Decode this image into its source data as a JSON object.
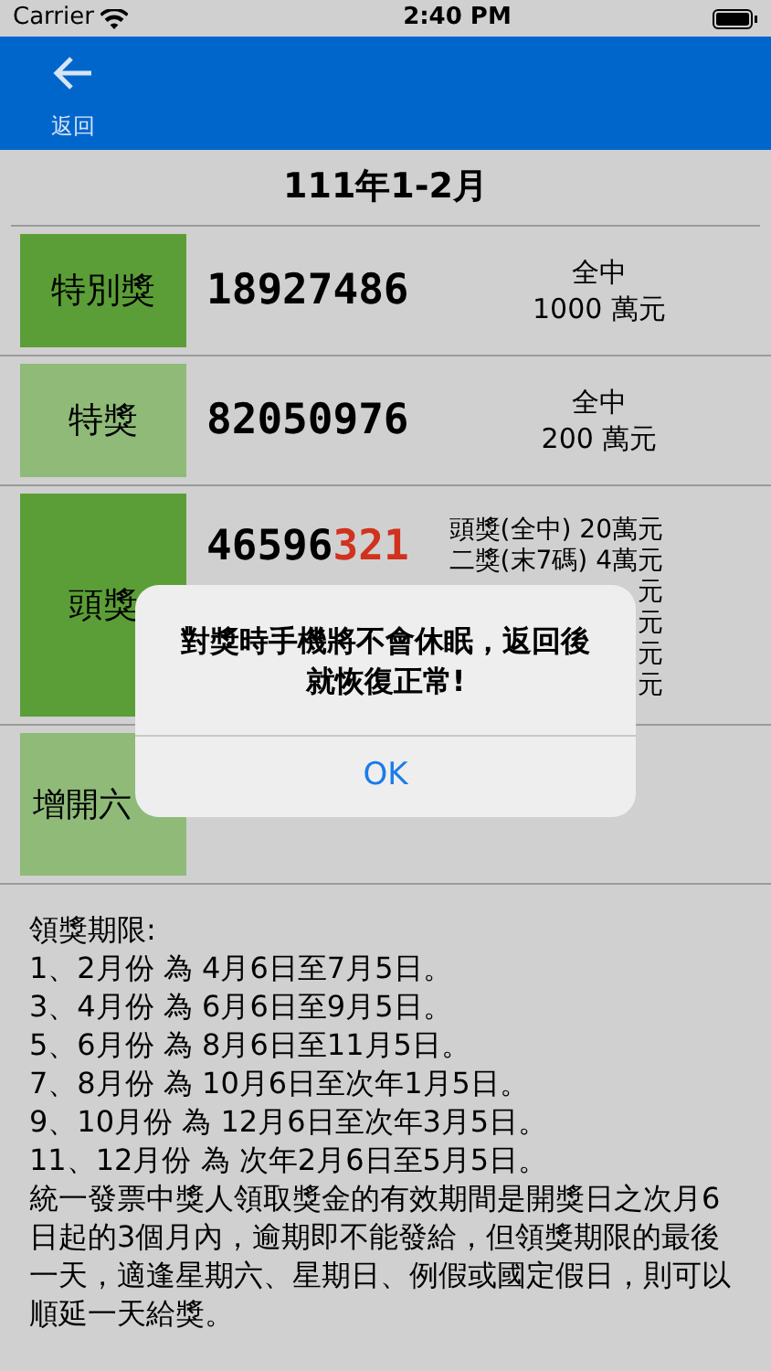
{
  "status_bar": {
    "carrier": "Carrier",
    "time": "2:40 PM"
  },
  "nav": {
    "back_label": "返回"
  },
  "title": "111年1-2月",
  "prizes": [
    {
      "kind": "simple",
      "label": "特別獎",
      "color": "#5b9e37",
      "number": "18927486",
      "lines": [
        "全中",
        "1000 萬元"
      ]
    },
    {
      "kind": "simple",
      "label": "特獎",
      "color": "#8fba78",
      "number": "82050976",
      "lines": [
        "全中",
        "200 萬元"
      ]
    },
    {
      "kind": "list",
      "label": "頭獎",
      "color": "#5b9e37",
      "number": "46596",
      "number_highlight": "321",
      "lines": [
        "頭獎(全中) 20萬元",
        "二獎(末7碼) 4萬元",
        "元",
        "元",
        "元",
        "元"
      ]
    },
    {
      "kind": "empty",
      "label": "增開六",
      "color": "#8fba78"
    }
  ],
  "notes": [
    "領獎期限:",
    "1、2月份 為 4月6日至7月5日。",
    "3、4月份 為 6月6日至9月5日。",
    "5、6月份 為 8月6日至11月5日。",
    "7、8月份 為 10月6日至次年1月5日。",
    "9、10月份 為 12月6日至次年3月5日。",
    "11、12月份 為 次年2月6日至5月5日。",
    "統一發票中獎人領取獎金的有效期間是開獎日之次月6日起的3個月內，逾期即不能發給，但領獎期限的最後一天，適逢星期六、星期日、例假或國定假日，則可以順延一天給獎。"
  ],
  "alert": {
    "message": "對獎時手機將不會休眠，返回後就恢復正常!",
    "button": "OK"
  }
}
